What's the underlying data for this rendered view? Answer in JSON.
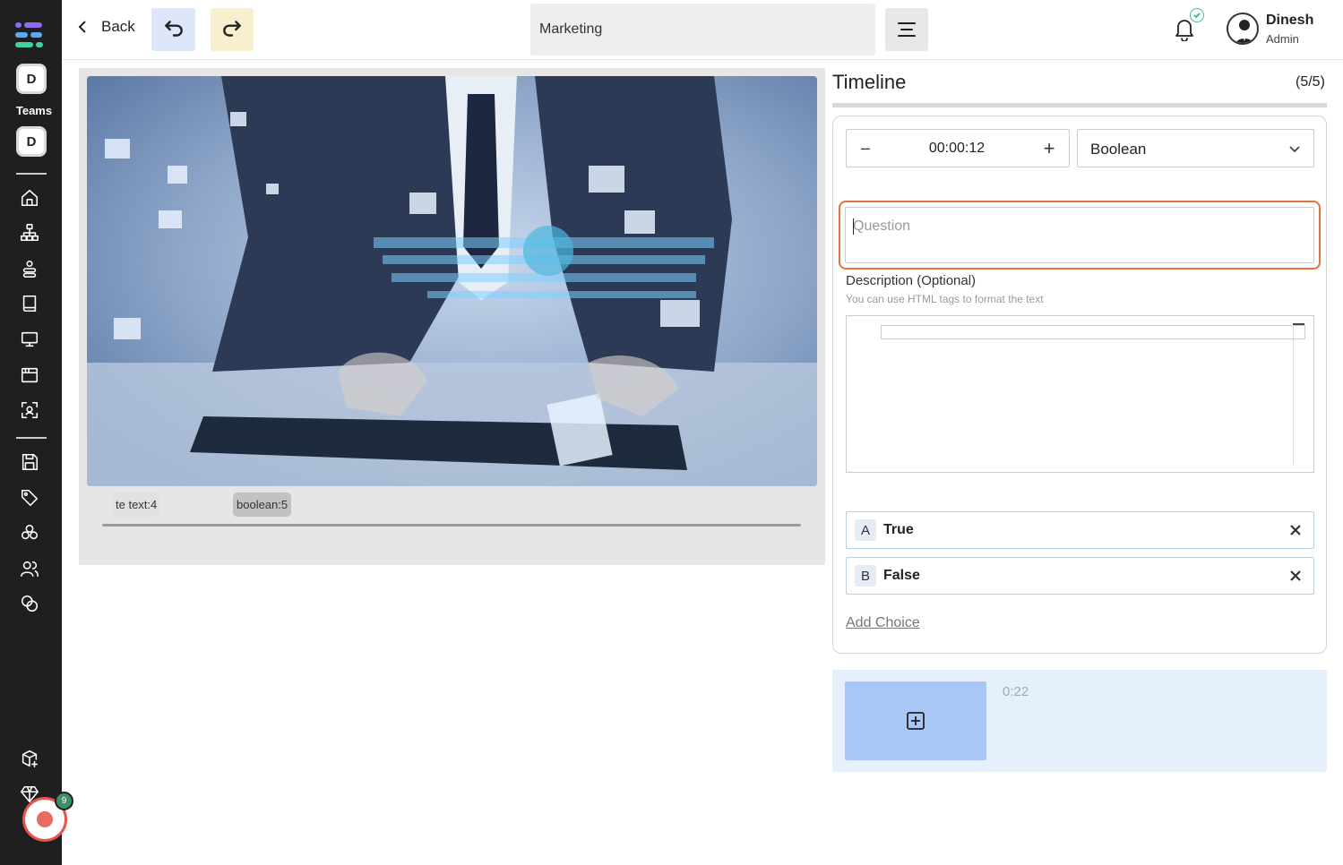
{
  "sidebar": {
    "team_initial_top": "D",
    "teams_label": "Teams",
    "team_initial": "D",
    "record_count": "9"
  },
  "topbar": {
    "back_label": "Back",
    "title": "Marketing",
    "user_name": "Dinesh",
    "user_role": "Admin"
  },
  "video": {
    "markers": [
      "te text:4",
      "boolean:5"
    ]
  },
  "timeline": {
    "title": "Timeline",
    "count": "(5/5)",
    "stepper_minus": "–",
    "time_value": "00:00:12",
    "stepper_plus": "+",
    "type_value": "Boolean",
    "question_placeholder": "Question",
    "description_label": "Description (Optional)",
    "description_hint": "You can use HTML tags to format the text",
    "choices": [
      {
        "letter": "A",
        "text": "True"
      },
      {
        "letter": "B",
        "text": "False"
      }
    ],
    "add_choice_label": "Add Choice",
    "clip_time": "0:22"
  },
  "colors": {
    "sidebar_bg": "#1f1f1f",
    "focus_orange": "#e8713d",
    "choice_border": "#b9cfe4",
    "clip_strip_bg": "#e6f0fc",
    "add_clip_bg": "#a9c7f6",
    "undo_bg": "#dde7f8",
    "redo_bg": "#f8efcf"
  }
}
